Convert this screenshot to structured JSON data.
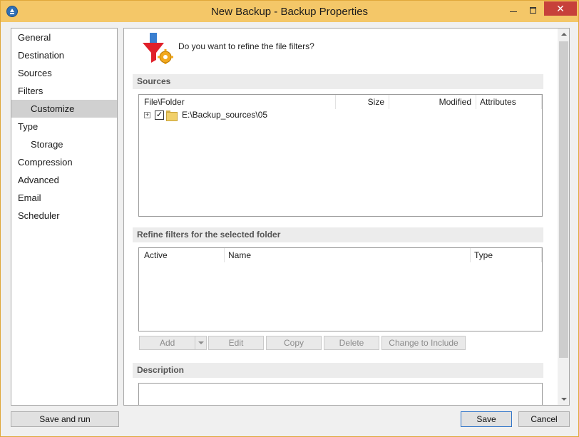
{
  "window": {
    "title": "New Backup - Backup Properties"
  },
  "titlebar": {
    "minimize": "–",
    "maximize": "□",
    "close": "✕"
  },
  "nav": {
    "items": [
      {
        "label": "General"
      },
      {
        "label": "Destination"
      },
      {
        "label": "Sources"
      },
      {
        "label": "Filters"
      },
      {
        "label": "Customize",
        "selected": true
      },
      {
        "label": "Type"
      },
      {
        "label": "Storage"
      },
      {
        "label": "Compression"
      },
      {
        "label": "Advanced"
      },
      {
        "label": "Email"
      },
      {
        "label": "Scheduler"
      }
    ]
  },
  "page": {
    "question": "Do you want to refine the file filters?"
  },
  "sources": {
    "header": "Sources",
    "columns": {
      "file_folder": "File\\Folder",
      "size": "Size",
      "modified": "Modified",
      "attributes": "Attributes"
    },
    "rows": [
      {
        "path": "E:\\Backup_sources\\05",
        "checked": true,
        "expander": "+",
        "checkmark": "✓"
      }
    ]
  },
  "refine": {
    "header": "Refine filters for the selected folder",
    "columns": {
      "active": "Active",
      "name": "Name",
      "type": "Type"
    }
  },
  "actions": {
    "add": "Add",
    "edit": "Edit",
    "copy": "Copy",
    "delete": "Delete",
    "change_to_include": "Change to Include"
  },
  "description": {
    "header": "Description",
    "text": ""
  },
  "footer": {
    "save_and_run": "Save and run",
    "save": "Save",
    "cancel": "Cancel"
  },
  "colors": {
    "titlebar": "#f4c768",
    "close_button": "#c7413a",
    "selected_nav": "#d0d0d0",
    "filter_icon": "#e0202a",
    "gear_icon": "#f2a81d"
  }
}
